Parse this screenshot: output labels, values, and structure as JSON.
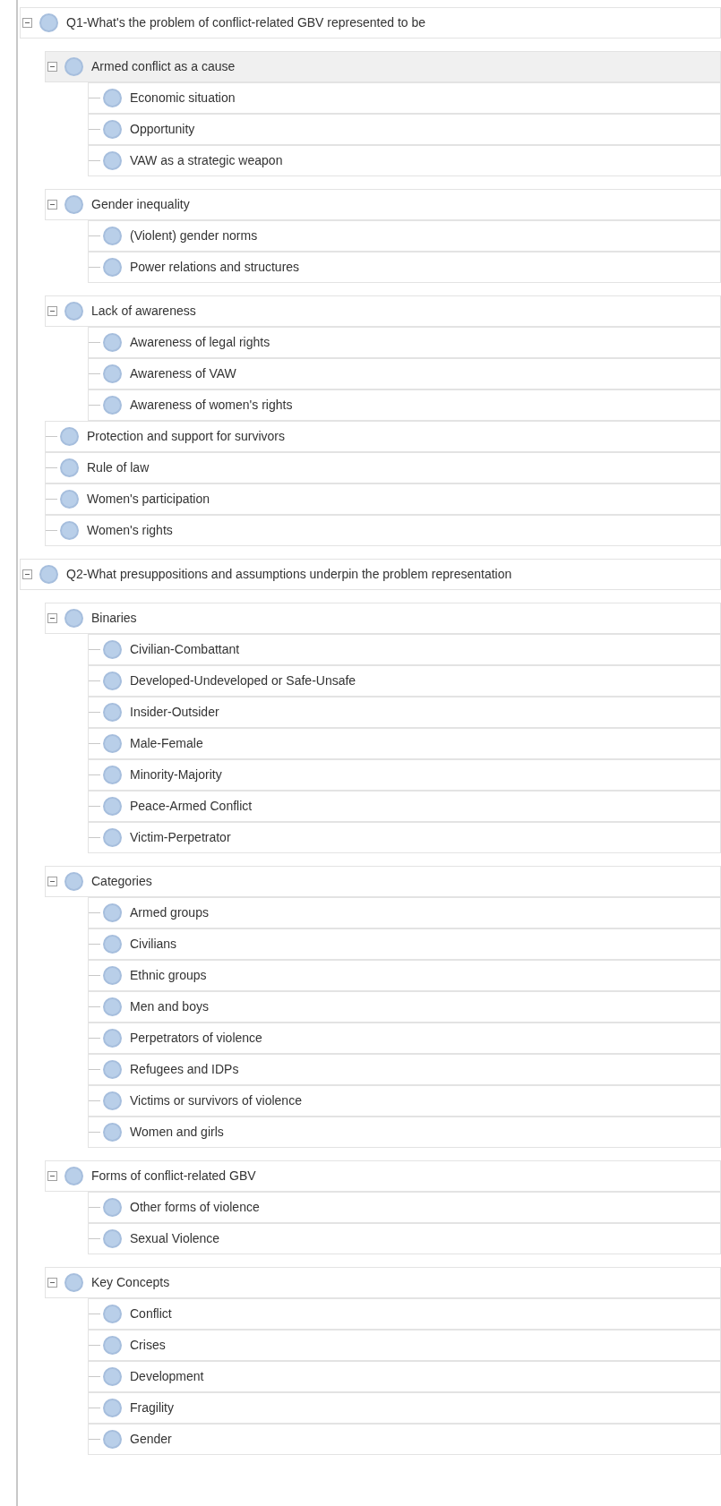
{
  "tree": [
    {
      "label": "Q1-What's the problem of conflict-related GBV represented to be",
      "expanded": true,
      "selected": false,
      "children": [
        {
          "label": "Armed conflict as a cause",
          "expanded": true,
          "selected": true,
          "children": [
            {
              "label": "Economic situation",
              "selected": false
            },
            {
              "label": "Opportunity",
              "selected": false
            },
            {
              "label": "VAW as a strategic weapon",
              "selected": false
            }
          ]
        },
        {
          "label": "Gender inequality",
          "expanded": true,
          "selected": false,
          "children": [
            {
              "label": "(Violent) gender norms",
              "selected": false
            },
            {
              "label": "Power relations and structures",
              "selected": false
            }
          ]
        },
        {
          "label": "Lack of awareness",
          "expanded": true,
          "selected": false,
          "children": [
            {
              "label": "Awareness of legal rights",
              "selected": false
            },
            {
              "label": "Awareness of VAW",
              "selected": false
            },
            {
              "label": "Awareness of women's rights",
              "selected": false
            }
          ]
        },
        {
          "label": "Protection and support for survivors",
          "selected": false
        },
        {
          "label": "Rule of law",
          "selected": false
        },
        {
          "label": "Women's participation",
          "selected": false
        },
        {
          "label": "Women's rights",
          "selected": false
        }
      ]
    },
    {
      "label": "Q2-What presuppositions and assumptions underpin the problem representation",
      "expanded": true,
      "selected": false,
      "children": [
        {
          "label": "Binaries",
          "expanded": true,
          "selected": false,
          "children": [
            {
              "label": "Civilian-Combattant",
              "selected": false
            },
            {
              "label": "Developed-Undeveloped or Safe-Unsafe",
              "selected": false
            },
            {
              "label": "Insider-Outsider",
              "selected": false
            },
            {
              "label": "Male-Female",
              "selected": false
            },
            {
              "label": "Minority-Majority",
              "selected": false
            },
            {
              "label": "Peace-Armed Conflict",
              "selected": false
            },
            {
              "label": "Victim-Perpetrator",
              "selected": false
            }
          ]
        },
        {
          "label": "Categories",
          "expanded": true,
          "selected": false,
          "children": [
            {
              "label": "Armed groups",
              "selected": false
            },
            {
              "label": "Civilians",
              "selected": false
            },
            {
              "label": "Ethnic groups",
              "selected": false
            },
            {
              "label": "Men and boys",
              "selected": false
            },
            {
              "label": "Perpetrators of violence",
              "selected": false
            },
            {
              "label": "Refugees and IDPs",
              "selected": false
            },
            {
              "label": "Victims or survivors of violence",
              "selected": false
            },
            {
              "label": "Women and girls",
              "selected": false
            }
          ]
        },
        {
          "label": "Forms of conflict-related GBV",
          "expanded": true,
          "selected": false,
          "children": [
            {
              "label": "Other forms of violence",
              "selected": false
            },
            {
              "label": "Sexual Violence",
              "selected": false
            }
          ]
        },
        {
          "label": "Key Concepts",
          "expanded": true,
          "selected": false,
          "children": [
            {
              "label": "Conflict",
              "selected": false
            },
            {
              "label": "Crises",
              "selected": false
            },
            {
              "label": "Development",
              "selected": false
            },
            {
              "label": "Fragility",
              "selected": false
            },
            {
              "label": "Gender",
              "selected": false
            }
          ]
        }
      ]
    }
  ]
}
